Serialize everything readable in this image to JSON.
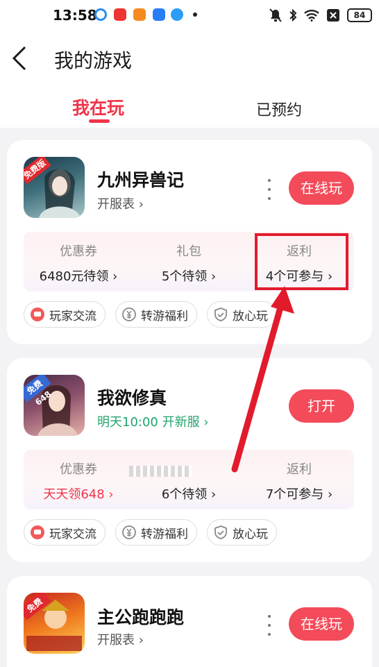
{
  "status_bar": {
    "time": "13:58",
    "battery": "84"
  },
  "header": {
    "title": "我的游戏",
    "back_icon": "chevron-left-icon"
  },
  "tabs": [
    {
      "label": "我在玩",
      "active": true
    },
    {
      "label": "已预约",
      "active": false
    }
  ],
  "games": [
    {
      "name": "九州异兽记",
      "subtitle": "开服表 ›",
      "badge": "免费版",
      "action": "在线玩",
      "benefits": [
        {
          "title": "优惠券",
          "value": "6480元待领 ›"
        },
        {
          "title": "礼包",
          "value": "5个待领 ›"
        },
        {
          "title": "返利",
          "value": "4个可参与 ›"
        }
      ]
    },
    {
      "name": "我欲修真",
      "subtitle": "明天10:00 开新服 ›",
      "badge": "免费648",
      "action": "打开",
      "benefits": [
        {
          "title": "优惠券",
          "value": "天天领648 ›"
        },
        {
          "title": "礼包",
          "value": "6个待领 ›"
        },
        {
          "title": "返利",
          "value": "7个可参与 ›"
        }
      ]
    },
    {
      "name": "主公跑跑跑",
      "subtitle": "开服表 ›",
      "badge": "免费",
      "action": "在线玩"
    }
  ],
  "tags": [
    "玩家交流",
    "转游福利",
    "放心玩"
  ],
  "colors": {
    "accent": "#f0344b",
    "button": "#f34b5a",
    "green": "#22a46c",
    "annotation": "#e21b2c"
  }
}
